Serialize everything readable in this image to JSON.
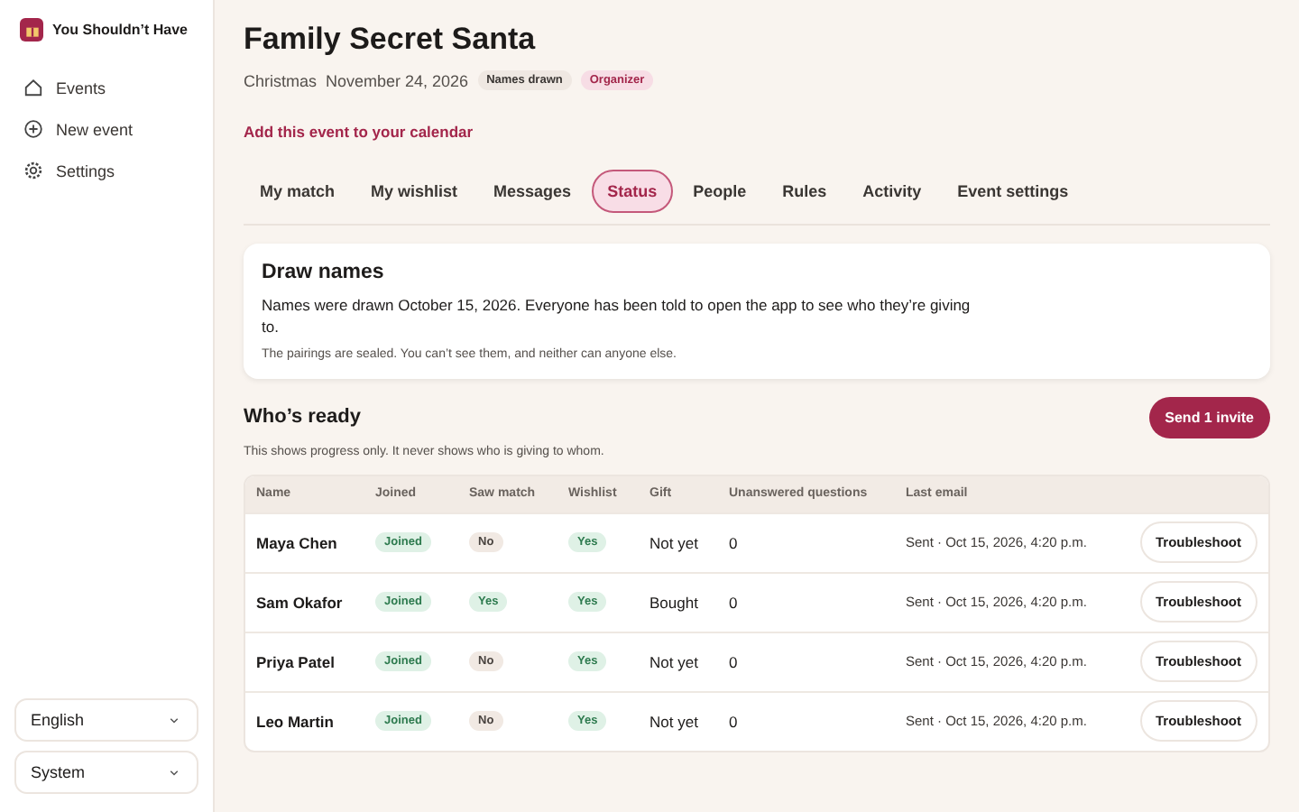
{
  "app": {
    "name": "You Shouldn’t Have"
  },
  "sidebar": {
    "items": [
      {
        "label": "Events",
        "selected": false
      },
      {
        "label": "New event",
        "selected": false
      },
      {
        "label": "Settings",
        "selected": false
      }
    ],
    "language": "English",
    "theme": "System"
  },
  "event": {
    "title": "Family Secret Santa",
    "occasion": "Christmas",
    "date": "November 24, 2026",
    "badges": [
      {
        "label": "Names drawn",
        "kind": "neutral"
      },
      {
        "label": "Organizer",
        "kind": "accent"
      }
    ],
    "calendar_link": "Add this event to your calendar"
  },
  "tabs": [
    {
      "label": "My match",
      "selected": false
    },
    {
      "label": "My wishlist",
      "selected": false
    },
    {
      "label": "Messages",
      "selected": false
    },
    {
      "label": "Status",
      "selected": true
    },
    {
      "label": "People",
      "selected": false
    },
    {
      "label": "Rules",
      "selected": false
    },
    {
      "label": "Activity",
      "selected": false
    },
    {
      "label": "Event settings",
      "selected": false
    }
  ],
  "draw_card": {
    "title": "Draw names",
    "text": "Names were drawn October 15, 2026. Everyone has been told to open the app to see who they’re giving to.",
    "note": "The pairings are sealed. You can’t see them, and neither can anyone else."
  },
  "ready": {
    "title": "Who’s ready",
    "button": "Send 1 invite",
    "note": "This shows progress only. It never shows who is giving to whom."
  },
  "table": {
    "columns": [
      "Name",
      "Joined",
      "Saw match",
      "Wishlist",
      "Gift",
      "Unanswered questions",
      "Last email"
    ],
    "rows": [
      {
        "name": "Maya Chen",
        "joined": {
          "label": "Joined",
          "on": true
        },
        "saw_match": {
          "label": "No",
          "on": false
        },
        "wishlist": {
          "label": "Yes",
          "on": true
        },
        "gift": "Not yet",
        "questions": "0",
        "last_email": "Sent · Oct 15, 2026, 4:20 p.m.",
        "action": "Troubleshoot"
      },
      {
        "name": "Sam Okafor",
        "joined": {
          "label": "Joined",
          "on": true
        },
        "saw_match": {
          "label": "Yes",
          "on": true
        },
        "wishlist": {
          "label": "Yes",
          "on": true
        },
        "gift": "Bought",
        "questions": "0",
        "last_email": "Sent · Oct 15, 2026, 4:20 p.m.",
        "action": "Troubleshoot"
      },
      {
        "name": "Priya Patel",
        "joined": {
          "label": "Joined",
          "on": true
        },
        "saw_match": {
          "label": "No",
          "on": false
        },
        "wishlist": {
          "label": "Yes",
          "on": true
        },
        "gift": "Not yet",
        "questions": "0",
        "last_email": "Sent · Oct 15, 2026, 4:20 p.m.",
        "action": "Troubleshoot"
      },
      {
        "name": "Leo Martin",
        "joined": {
          "label": "Joined",
          "on": true
        },
        "saw_match": {
          "label": "No",
          "on": false
        },
        "wishlist": {
          "label": "Yes",
          "on": true
        },
        "gift": "Not yet",
        "questions": "0",
        "last_email": "Sent · Oct 15, 2026, 4:20 p.m.",
        "action": "Troubleshoot"
      }
    ]
  }
}
